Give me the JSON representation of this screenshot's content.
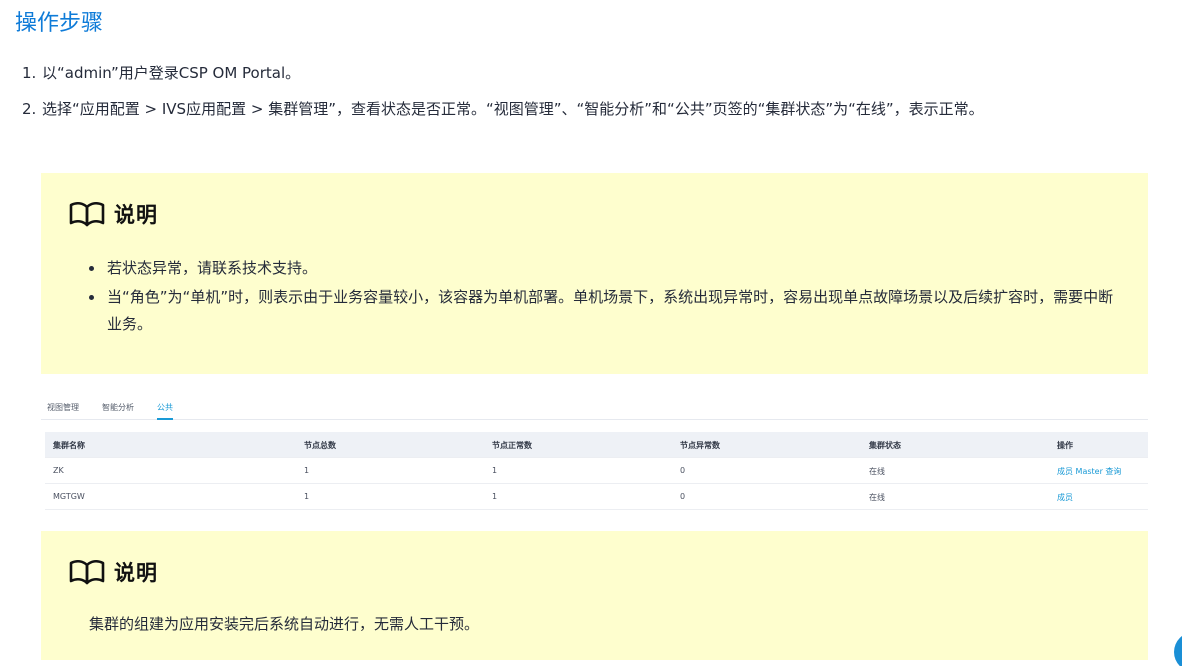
{
  "section_title": "操作步骤",
  "steps": [
    {
      "num": "1.",
      "text": "以“admin”用户登录CSP OM Portal。"
    },
    {
      "num": "2.",
      "text": "选择“应用配置 > IVS应用配置 > 集群管理”，查看状态是否正常。“视图管理”、“智能分析”和“公共”页签的“集群状态”为“在线”，表示正常。"
    }
  ],
  "note1": {
    "title": "说明",
    "items": [
      "若状态异常，请联系技术支持。",
      "当“角色”为“单机”时，则表示由于业务容量较小，该容器为单机部署。单机场景下，系统出现异常时，容易出现单点故障场景以及后续扩容时，需要中断业务。"
    ]
  },
  "screenshot": {
    "tabs": [
      "视图管理",
      "智能分析",
      "公共"
    ],
    "active_tab": "公共",
    "columns": [
      "集群名称",
      "节点总数",
      "节点正常数",
      "节点异常数",
      "集群状态",
      "操作"
    ],
    "rows": [
      {
        "name": "ZK",
        "total": "1",
        "normal": "1",
        "abnormal": "0",
        "status": "在线",
        "actions": "成员  Master 查询"
      },
      {
        "name": "MGTGW",
        "total": "1",
        "normal": "1",
        "abnormal": "0",
        "status": "在线",
        "actions": "成员"
      }
    ]
  },
  "note2": {
    "title": "说明",
    "text": "集群的组建为应用安装完后系统自动进行，无需人工干预。"
  },
  "colors": {
    "title_blue": "#0e7bd8",
    "note_bg": "#fefece",
    "link": "#1a9ad6"
  },
  "icons": {
    "note": "book-icon",
    "floating": "floating-action-button"
  }
}
